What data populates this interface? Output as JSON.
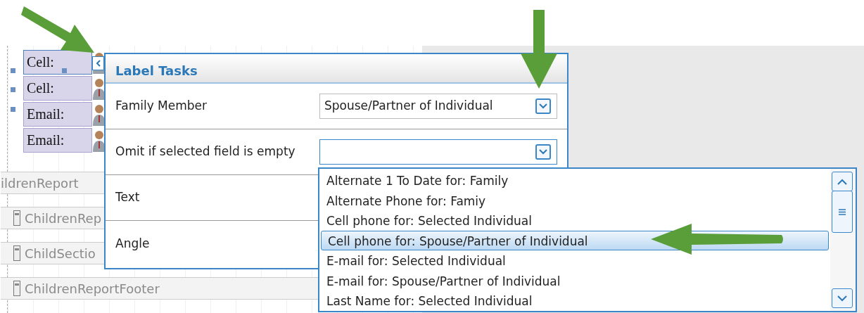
{
  "labels": [
    {
      "text": "Cell:",
      "selected": true
    },
    {
      "text": "Cell:",
      "selected": false
    },
    {
      "text": "Email:",
      "selected": false
    },
    {
      "text": "Email:",
      "selected": false
    }
  ],
  "bands": [
    {
      "text": "ildrenReport",
      "kind": "header"
    },
    {
      "text": "ChildrenRep",
      "kind": "section"
    },
    {
      "text": "ChildSectio",
      "kind": "section"
    },
    {
      "text": "ChildrenReportFooter",
      "kind": "section"
    }
  ],
  "popup": {
    "title": "Label Tasks",
    "rows": [
      {
        "label": "Family Member",
        "kind": "combo",
        "value": "Spouse/Partner of Individual",
        "expanded": false
      },
      {
        "label": "Omit if selected field is empty",
        "kind": "combo",
        "expanded": true
      },
      {
        "label": "Text",
        "kind": "plain"
      },
      {
        "label": "Angle",
        "kind": "plain"
      }
    ]
  },
  "dropdown": {
    "items": [
      {
        "text": "Alternate 1 To Date for: Family",
        "selected": false
      },
      {
        "text": "Alternate Phone for: Famiy",
        "selected": false
      },
      {
        "text": "Cell phone for: Selected Individual",
        "selected": false
      },
      {
        "text": "Cell phone for: Spouse/Partner of Individual",
        "selected": true
      },
      {
        "text": "E-mail for: Selected Individual",
        "selected": false
      },
      {
        "text": "E-mail for: Spouse/Partner of Individual",
        "selected": false
      },
      {
        "text": "Last Name for: Selected Individual",
        "selected": false
      }
    ]
  }
}
